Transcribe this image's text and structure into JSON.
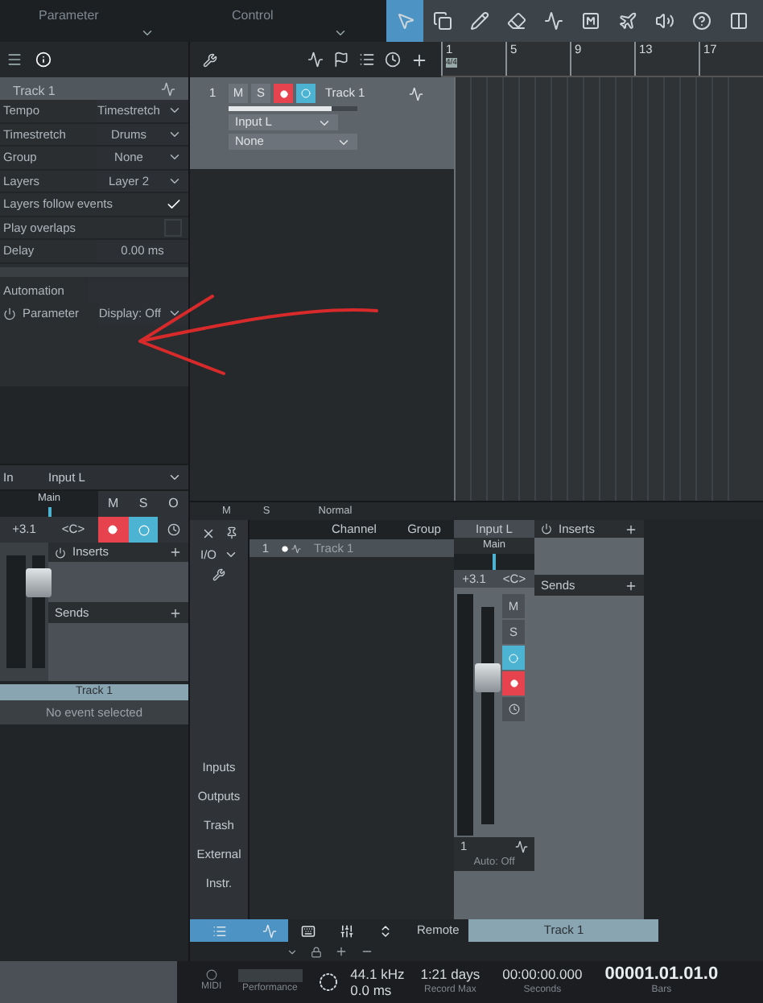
{
  "top_bar": {
    "labels": [
      "Parameter",
      "Control"
    ],
    "tools": [
      {
        "kind": "pointer",
        "selected": true
      },
      {
        "kind": "range",
        "selected": false
      },
      {
        "kind": "pencil",
        "selected": false
      },
      {
        "kind": "eraser",
        "selected": false
      },
      {
        "kind": "bend",
        "selected": false
      },
      {
        "kind": "mute",
        "selected": false
      },
      {
        "kind": "split",
        "selected": false
      },
      {
        "kind": "listen",
        "selected": false
      },
      {
        "kind": "help",
        "selected": false
      },
      {
        "kind": "view",
        "selected": false
      }
    ]
  },
  "inspector": {
    "track": "Track 1",
    "rows": [
      {
        "kind": "select",
        "label": "Tempo",
        "value": "Timestretch"
      },
      {
        "kind": "select",
        "label": "Timestretch",
        "value": "Drums"
      },
      {
        "kind": "select",
        "label": "Group",
        "value": "None"
      },
      {
        "kind": "select",
        "label": "Layers",
        "value": "Layer 2"
      },
      {
        "kind": "check",
        "label": "Layers follow events",
        "checked": true
      },
      {
        "kind": "check",
        "label": "Play overlaps",
        "checked": false
      },
      {
        "kind": "value",
        "label": "Delay",
        "value": "0.00 ms"
      }
    ],
    "automation": "Automation",
    "parameter": "Parameter",
    "display": "Display: Off"
  },
  "arrange": {
    "ruler": [
      "1",
      "5",
      "9",
      "13",
      "17"
    ],
    "time_signature": "4/4",
    "track": {
      "number": "1",
      "mute": "M",
      "solo": "S",
      "record_armed": true,
      "monitor": true,
      "name": "Track 1",
      "input": "Input L",
      "output": "None",
      "level": 0.8
    },
    "footer": [
      "M",
      "S",
      "Normal"
    ]
  },
  "channel_strip": {
    "input_label": "In",
    "input": "Input L",
    "output": "Main",
    "buttons": [
      "M",
      "S",
      "O"
    ],
    "volume": "+3.1",
    "pan": "<C>",
    "record_armed": true,
    "monitor": true,
    "inserts": "Inserts",
    "sends": "Sends",
    "level": 0.85,
    "name": "Track 1"
  },
  "event_info": "No event selected",
  "mixer": {
    "io": "I/O",
    "sidebar": [
      "Inputs",
      "Outputs",
      "Trash",
      "External",
      "Instr."
    ],
    "columns": [
      "Channel",
      "Group"
    ],
    "rows": [
      {
        "number": "1",
        "name": "Track 1",
        "selected": true
      }
    ],
    "strip": {
      "input": "Input L",
      "output": "Main",
      "volume": "+3.1",
      "pan": "<C>",
      "pan_slider": {
        "level": 0.5
      },
      "mute": "M",
      "solo": "S",
      "monitor": true,
      "record_armed": true,
      "number": "1",
      "automation": "Auto: Off",
      "name": "Track 1",
      "level": 0.7,
      "inserts": "Inserts",
      "sends": "Sends"
    },
    "tabs": [
      {
        "kind": "list",
        "selected": true
      },
      {
        "kind": "mixer",
        "selected": true
      },
      {
        "kind": "keyboard",
        "selected": false
      },
      {
        "kind": "fx",
        "selected": false
      },
      {
        "kind": "io",
        "selected": false
      }
    ],
    "remote": "Remote"
  },
  "status_bar": {
    "midi": "MIDI",
    "performance": "Performance",
    "sample_rate": "44.1 kHz",
    "latency": "0.0 ms",
    "record_max": "1:21 days",
    "record_max_label": "Record Max",
    "seconds": "00:00:00.000",
    "seconds_label": "Seconds",
    "bars": "00001.01.01.0",
    "bars_label": "Bars"
  }
}
